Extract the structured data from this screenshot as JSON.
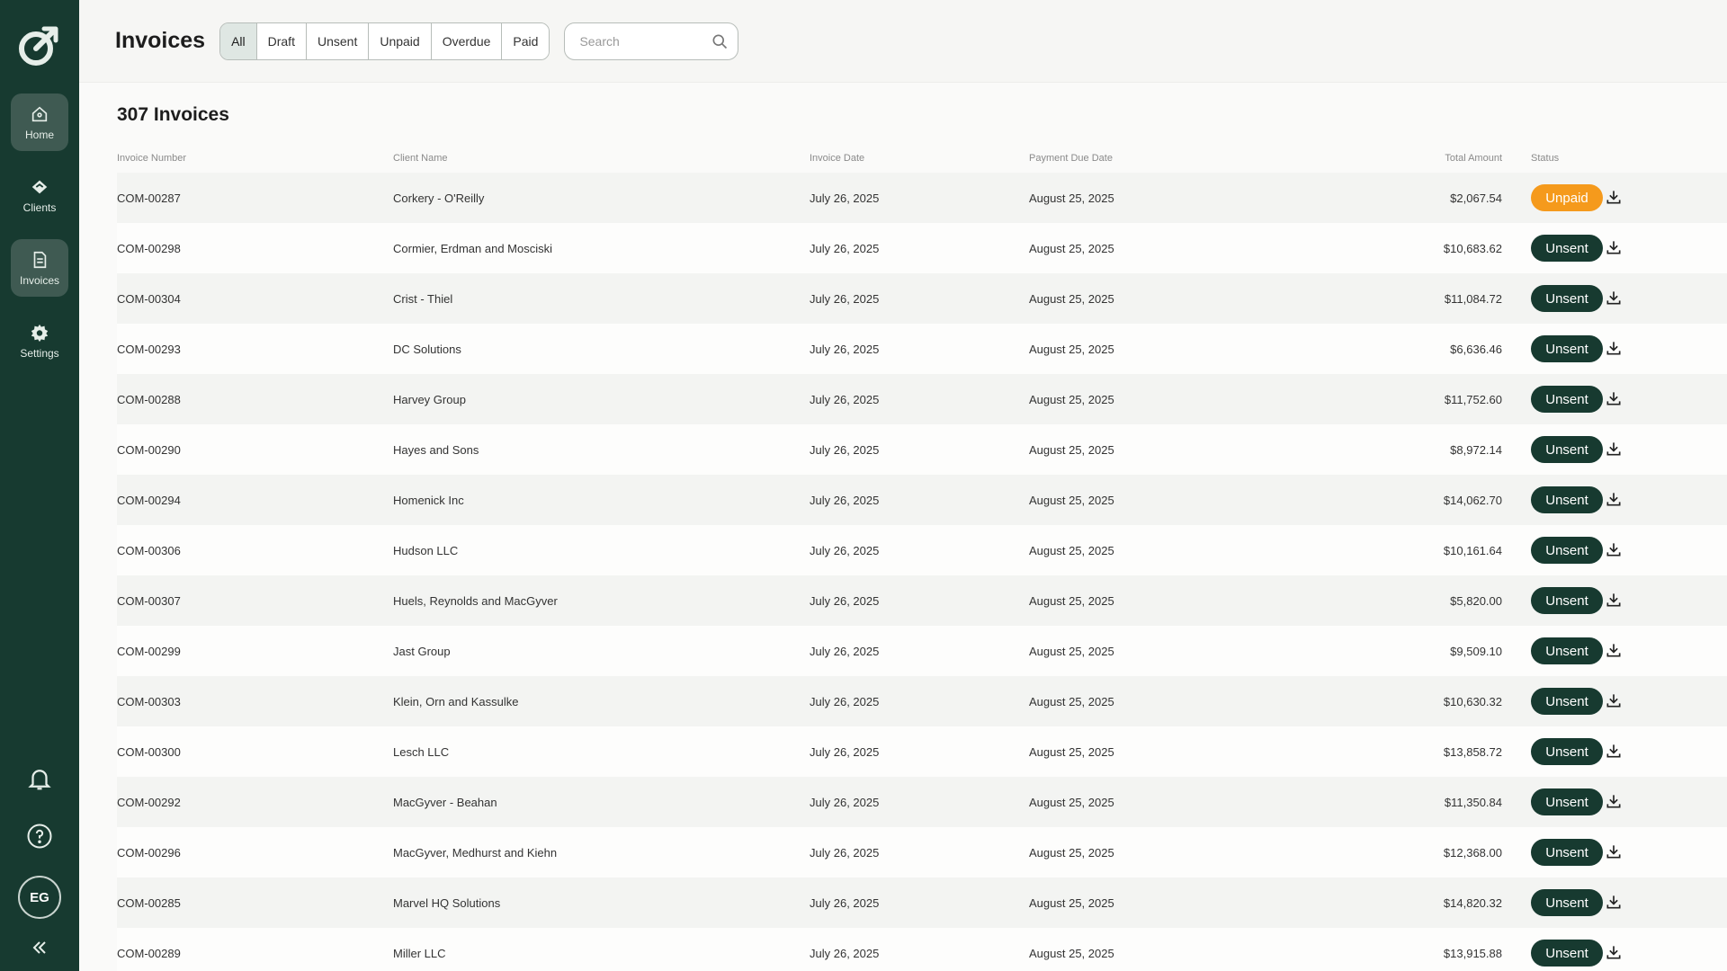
{
  "sidebar": {
    "items": [
      {
        "label": "Home",
        "icon": "home-icon",
        "active": true
      },
      {
        "label": "Clients",
        "icon": "handshake-icon",
        "active": false
      },
      {
        "label": "Invoices",
        "icon": "invoice-icon",
        "active": true
      },
      {
        "label": "Settings",
        "icon": "gear-icon",
        "active": false
      }
    ],
    "avatar_initials": "EG"
  },
  "header": {
    "title": "Invoices",
    "filters": [
      "All",
      "Draft",
      "Unsent",
      "Unpaid",
      "Overdue",
      "Paid"
    ],
    "active_filter": "All",
    "search_placeholder": "Search"
  },
  "main": {
    "count_label": "307 Invoices",
    "columns": [
      "Invoice Number",
      "Client Name",
      "Invoice Date",
      "Payment Due Date",
      "Total Amount",
      "Status"
    ],
    "rows": [
      {
        "number": "COM-00287",
        "client": "Corkery - O'Reilly",
        "date": "July 26, 2025",
        "due": "August 25, 2025",
        "amount": "$2,067.54",
        "status": "Unpaid"
      },
      {
        "number": "COM-00298",
        "client": "Cormier, Erdman and Mosciski",
        "date": "July 26, 2025",
        "due": "August 25, 2025",
        "amount": "$10,683.62",
        "status": "Unsent"
      },
      {
        "number": "COM-00304",
        "client": "Crist - Thiel",
        "date": "July 26, 2025",
        "due": "August 25, 2025",
        "amount": "$11,084.72",
        "status": "Unsent"
      },
      {
        "number": "COM-00293",
        "client": "DC Solutions",
        "date": "July 26, 2025",
        "due": "August 25, 2025",
        "amount": "$6,636.46",
        "status": "Unsent"
      },
      {
        "number": "COM-00288",
        "client": "Harvey Group",
        "date": "July 26, 2025",
        "due": "August 25, 2025",
        "amount": "$11,752.60",
        "status": "Unsent"
      },
      {
        "number": "COM-00290",
        "client": "Hayes and Sons",
        "date": "July 26, 2025",
        "due": "August 25, 2025",
        "amount": "$8,972.14",
        "status": "Unsent"
      },
      {
        "number": "COM-00294",
        "client": "Homenick Inc",
        "date": "July 26, 2025",
        "due": "August 25, 2025",
        "amount": "$14,062.70",
        "status": "Unsent"
      },
      {
        "number": "COM-00306",
        "client": "Hudson LLC",
        "date": "July 26, 2025",
        "due": "August 25, 2025",
        "amount": "$10,161.64",
        "status": "Unsent"
      },
      {
        "number": "COM-00307",
        "client": "Huels, Reynolds and MacGyver",
        "date": "July 26, 2025",
        "due": "August 25, 2025",
        "amount": "$5,820.00",
        "status": "Unsent"
      },
      {
        "number": "COM-00299",
        "client": "Jast Group",
        "date": "July 26, 2025",
        "due": "August 25, 2025",
        "amount": "$9,509.10",
        "status": "Unsent"
      },
      {
        "number": "COM-00303",
        "client": "Klein, Orn and Kassulke",
        "date": "July 26, 2025",
        "due": "August 25, 2025",
        "amount": "$10,630.32",
        "status": "Unsent"
      },
      {
        "number": "COM-00300",
        "client": "Lesch LLC",
        "date": "July 26, 2025",
        "due": "August 25, 2025",
        "amount": "$13,858.72",
        "status": "Unsent"
      },
      {
        "number": "COM-00292",
        "client": "MacGyver - Beahan",
        "date": "July 26, 2025",
        "due": "August 25, 2025",
        "amount": "$11,350.84",
        "status": "Unsent"
      },
      {
        "number": "COM-00296",
        "client": "MacGyver, Medhurst and Kiehn",
        "date": "July 26, 2025",
        "due": "August 25, 2025",
        "amount": "$12,368.00",
        "status": "Unsent"
      },
      {
        "number": "COM-00285",
        "client": "Marvel HQ Solutions",
        "date": "July 26, 2025",
        "due": "August 25, 2025",
        "amount": "$14,820.32",
        "status": "Unsent"
      },
      {
        "number": "COM-00289",
        "client": "Miller LLC",
        "date": "July 26, 2025",
        "due": "August 25, 2025",
        "amount": "$13,915.88",
        "status": "Unsent"
      }
    ]
  },
  "colors": {
    "sidebar_bg": "#173a30",
    "unsent_badge": "#173a30",
    "unpaid_badge": "#f59a1c"
  }
}
